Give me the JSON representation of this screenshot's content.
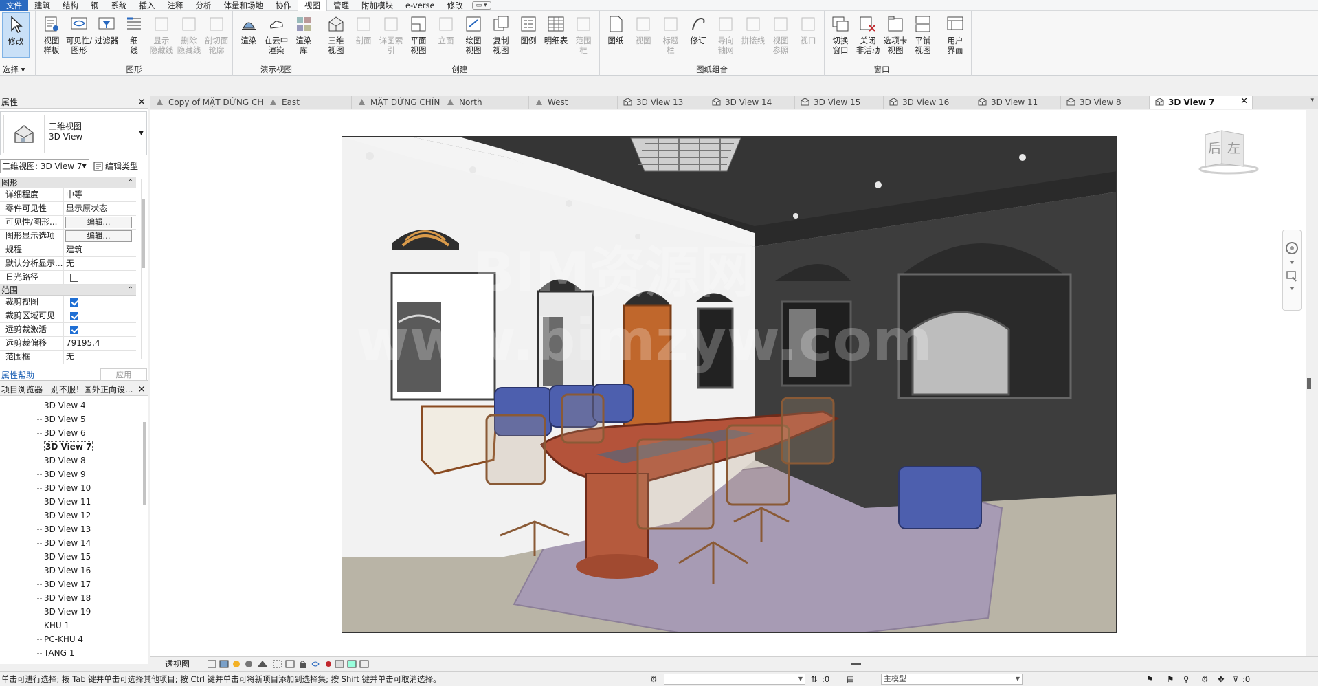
{
  "menu": {
    "tabs": [
      "文件",
      "建筑",
      "结构",
      "钢",
      "系统",
      "插入",
      "注释",
      "分析",
      "体量和场地",
      "协作",
      "视图",
      "管理",
      "附加模块",
      "e-verse",
      "修改"
    ],
    "active": "视图",
    "extra": "▭ ▾"
  },
  "ribbon": {
    "select_label": "选择 ▾",
    "groups": [
      {
        "title": "",
        "buttons": [
          {
            "label": "修改",
            "icon": "cursor-icon",
            "state": "selected"
          }
        ]
      },
      {
        "title": "图形",
        "buttons": [
          {
            "label": "视图\n样板",
            "icon": "view-template-icon",
            "state": "normal"
          },
          {
            "label": "可见性/\n图形",
            "icon": "visibility-graphics-icon",
            "state": "normal"
          },
          {
            "label": "过滤器",
            "icon": "filter-icon",
            "state": "normal"
          },
          {
            "label": "细\n线",
            "icon": "thin-lines-icon",
            "state": "normal"
          },
          {
            "label": "显示\n隐藏线",
            "icon": "show-hidden-lines-icon",
            "state": "disabled"
          },
          {
            "label": "删除\n隐藏线",
            "icon": "remove-hidden-lines-icon",
            "state": "disabled"
          },
          {
            "label": "剖切面\n轮廓",
            "icon": "cut-profile-icon",
            "state": "disabled"
          }
        ]
      },
      {
        "title": "演示视图",
        "buttons": [
          {
            "label": "渲染",
            "icon": "render-icon",
            "state": "normal"
          },
          {
            "label": "在云中\n渲染",
            "icon": "cloud-render-icon",
            "state": "normal"
          },
          {
            "label": "渲染\n库",
            "icon": "render-gallery-icon",
            "state": "normal"
          }
        ]
      },
      {
        "title": "创建",
        "buttons": [
          {
            "label": "三维\n视图",
            "icon": "3d-view-icon",
            "state": "normal"
          },
          {
            "label": "剖面",
            "icon": "section-icon",
            "state": "disabled"
          },
          {
            "label": "详图索引",
            "icon": "callout-icon",
            "state": "disabled"
          },
          {
            "label": "平面\n视图",
            "icon": "plan-view-icon",
            "state": "normal"
          },
          {
            "label": "立面",
            "icon": "elevation-icon",
            "state": "disabled"
          },
          {
            "label": "绘图\n视图",
            "icon": "drafting-view-icon",
            "state": "normal"
          },
          {
            "label": "复制\n视图",
            "icon": "duplicate-view-icon",
            "state": "normal"
          },
          {
            "label": "图例",
            "icon": "legend-icon",
            "state": "normal"
          },
          {
            "label": "明细表",
            "icon": "schedule-icon",
            "state": "normal"
          },
          {
            "label": "范围\n框",
            "icon": "scope-box-icon",
            "state": "disabled"
          }
        ]
      },
      {
        "title": "图纸组合",
        "buttons": [
          {
            "label": "图纸",
            "icon": "sheet-icon",
            "state": "normal"
          },
          {
            "label": "视图",
            "icon": "place-view-icon",
            "state": "disabled"
          },
          {
            "label": "标题\n栏",
            "icon": "title-block-icon",
            "state": "disabled"
          },
          {
            "label": "修订",
            "icon": "revisions-icon",
            "state": "normal"
          },
          {
            "label": "导向\n轴网",
            "icon": "guide-grid-icon",
            "state": "disabled"
          },
          {
            "label": "拼接线",
            "icon": "matchline-icon",
            "state": "disabled"
          },
          {
            "label": "视图\n参照",
            "icon": "view-reference-icon",
            "state": "disabled"
          },
          {
            "label": "视口",
            "icon": "viewport-icon",
            "state": "disabled"
          }
        ]
      },
      {
        "title": "窗口",
        "buttons": [
          {
            "label": "切换\n窗口",
            "icon": "switch-windows-icon",
            "state": "normal"
          },
          {
            "label": "关闭\n非活动",
            "icon": "close-inactive-icon",
            "state": "normal"
          },
          {
            "label": "选项卡\n视图",
            "icon": "tab-views-icon",
            "state": "normal"
          },
          {
            "label": "平铺\n视图",
            "icon": "tile-views-icon",
            "state": "normal"
          }
        ]
      },
      {
        "title": "",
        "buttons": [
          {
            "label": "用户\n界面",
            "icon": "user-interface-icon",
            "state": "normal"
          }
        ]
      }
    ]
  },
  "properties": {
    "title": "属性",
    "type_name_line1": "三维视图",
    "type_name_line2": "3D View",
    "view_selector": "三维视图: 3D View 7",
    "edit_type": "编辑类型",
    "sections": [
      {
        "name": "图形",
        "rows": [
          {
            "key": "详细程度",
            "value": "中等",
            "kind": "text"
          },
          {
            "key": "零件可见性",
            "value": "显示原状态",
            "kind": "text"
          },
          {
            "key": "可见性/图形...",
            "value": "编辑...",
            "kind": "button"
          },
          {
            "key": "图形显示选项",
            "value": "编辑...",
            "kind": "button"
          },
          {
            "key": "规程",
            "value": "建筑",
            "kind": "text"
          },
          {
            "key": "默认分析显示...",
            "value": "无",
            "kind": "text"
          },
          {
            "key": "日光路径",
            "value": "",
            "kind": "check-off"
          }
        ]
      },
      {
        "name": "范围",
        "rows": [
          {
            "key": "裁剪视图",
            "value": "",
            "kind": "check-on"
          },
          {
            "key": "裁剪区域可见",
            "value": "",
            "kind": "check-on"
          },
          {
            "key": "远剪裁激活",
            "value": "",
            "kind": "check-on"
          },
          {
            "key": "远剪裁偏移",
            "value": "79195.4",
            "kind": "text"
          },
          {
            "key": "范围框",
            "value": "无",
            "kind": "text"
          }
        ]
      }
    ],
    "help": "属性帮助",
    "apply": "应用"
  },
  "browser": {
    "title": "项目浏览器 - 别不服！国外正向设...",
    "items": [
      "3D View 4",
      "3D View 5",
      "3D View 6",
      "3D View 7",
      "3D View 8",
      "3D View 9",
      "3D View 10",
      "3D View 11",
      "3D View 12",
      "3D View 13",
      "3D View 14",
      "3D View 15",
      "3D View 16",
      "3D View 17",
      "3D View 18",
      "3D View 19",
      "KHU 1",
      "PC-KHU 4",
      "TANG 1"
    ],
    "current": "3D View 7"
  },
  "doc_tabs": [
    {
      "label": "Copy of MẶT ĐỨNG CHÍNH",
      "icon": "elevation-tab-icon"
    },
    {
      "label": "East",
      "icon": "elevation-tab-icon"
    },
    {
      "label": "MẶT ĐỨNG CHÍNH",
      "icon": "elevation-tab-icon"
    },
    {
      "label": "North",
      "icon": "elevation-tab-icon"
    },
    {
      "label": "West",
      "icon": "elevation-tab-icon"
    },
    {
      "label": "3D View 13",
      "icon": "3d-tab-icon"
    },
    {
      "label": "3D View 14",
      "icon": "3d-tab-icon"
    },
    {
      "label": "3D View 15",
      "icon": "3d-tab-icon"
    },
    {
      "label": "3D View 16",
      "icon": "3d-tab-icon"
    },
    {
      "label": "3D View 11",
      "icon": "3d-tab-icon"
    },
    {
      "label": "3D View 8",
      "icon": "3d-tab-icon"
    },
    {
      "label": "3D View 7",
      "icon": "3d-tab-icon",
      "active": true
    }
  ],
  "canvas": {
    "watermark_line1": "BIM资源网",
    "watermark_line2": "www.bimzyw.com",
    "viewcube_left": "后",
    "viewcube_right": "左"
  },
  "view_control": {
    "scale": "透视图"
  },
  "status": {
    "message": "单击可进行选择; 按 Tab 键并单击可选择其他项目; 按 Ctrl 键并单击可将新项目添加到选择集; 按 Shift 键并单击可取消选择。",
    "coord": ":0",
    "model": "主模型",
    "filter_count": ":0"
  },
  "colors": {
    "accent": "#2a6ac0",
    "selected_bg": "#c9e0f7",
    "wall_dark": "#3d3d3d",
    "wall_white": "#f4f4f4",
    "table_wood": "#b4533a",
    "chair_blue": "#4d5fae",
    "carpet": "#9d8ea8"
  }
}
